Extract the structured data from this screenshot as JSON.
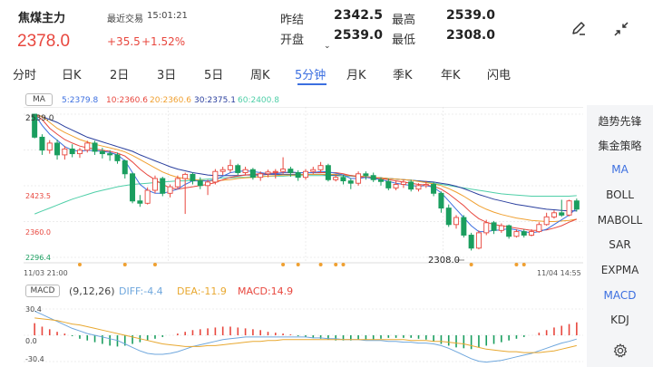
{
  "header": {
    "title": "焦煤主力",
    "last_trade_label": "最近交易",
    "last_trade_time": "15:01:21",
    "price": "2378.0",
    "change": "+35.5",
    "change_pct": "+1.52%",
    "prev_close_label": "昨结",
    "prev_close": "2342.5",
    "high_label": "最高",
    "high": "2539.0",
    "open_label": "开盘",
    "open": "2539.0",
    "low_label": "最低",
    "low": "2308.0",
    "up_color": "#e8473e",
    "down_color": "#1a9e5f"
  },
  "tabs": [
    {
      "label": "分时"
    },
    {
      "label": "日K"
    },
    {
      "label": "2日"
    },
    {
      "label": "3日"
    },
    {
      "label": "5日"
    },
    {
      "label": "周K"
    },
    {
      "label": "5分钟",
      "active": true
    },
    {
      "label": "月K"
    },
    {
      "label": "季K"
    },
    {
      "label": "年K"
    },
    {
      "label": "闪电"
    }
  ],
  "main_legend": {
    "badge": "MA",
    "ma5": "5:2379.8",
    "ma10": "10:2360.6",
    "ma20": "20:2360.6",
    "ma30": "30:2375.1",
    "ma60": "60:2400.8",
    "colors": {
      "ma5": "#3c6fe0",
      "ma10": "#e8473e",
      "ma20": "#f0a030",
      "ma30": "#2a3f9e",
      "ma60": "#4fcfa8"
    }
  },
  "price_axis": {
    "top": "2539.0",
    "y2": "2423.5",
    "y3": "2360.0",
    "y4": "2296.4",
    "low_marker": "2308.0"
  },
  "time_axis": {
    "start": "11/03 21:00",
    "end": "11/04 14:55"
  },
  "macd_legend": {
    "badge": "MACD",
    "params": "(9,12,26)",
    "diff": "DIFF:-4.4",
    "dea": "DEA:-11.9",
    "macd": "MACD:14.9",
    "y_top": "30.4",
    "y_mid": "0.0",
    "y_bot": "-30.4"
  },
  "side_menu": [
    {
      "label": "趋势先锋"
    },
    {
      "label": "集金策略"
    },
    {
      "label": "MA",
      "active": true
    },
    {
      "label": "BOLL"
    },
    {
      "label": "MABOLL"
    },
    {
      "label": "SAR"
    },
    {
      "label": "EXPMA"
    },
    {
      "label": "MACD",
      "active": true
    },
    {
      "label": "KDJ"
    }
  ],
  "chart_data": {
    "type": "candlestick",
    "y_range": [
      2296.4,
      2539.0
    ],
    "candles": [
      [
        2539.0,
        2500.0,
        2539.0,
        2498.0
      ],
      [
        2500.0,
        2478.0,
        2505.0,
        2470.0
      ],
      [
        2478.0,
        2490.0,
        2495.0,
        2472.0
      ],
      [
        2490.0,
        2470.0,
        2496.0,
        2462.0
      ],
      [
        2470.0,
        2480.0,
        2485.0,
        2462.0
      ],
      [
        2480.0,
        2472.0,
        2488.0,
        2466.0
      ],
      [
        2472.0,
        2478.0,
        2482.0,
        2465.0
      ],
      [
        2478.0,
        2490.0,
        2494.0,
        2474.0
      ],
      [
        2490.0,
        2476.0,
        2494.0,
        2470.0
      ],
      [
        2476.0,
        2472.0,
        2482.0,
        2464.0
      ],
      [
        2472.0,
        2470.0,
        2478.0,
        2460.0
      ],
      [
        2470.0,
        2460.0,
        2474.0,
        2455.0
      ],
      [
        2460.0,
        2438.0,
        2462.0,
        2430.0
      ],
      [
        2438.0,
        2392.0,
        2440.0,
        2388.0
      ],
      [
        2392.0,
        2388.0,
        2402.0,
        2382.0
      ],
      [
        2388.0,
        2410.0,
        2415.0,
        2386.0
      ],
      [
        2410.0,
        2430.0,
        2435.0,
        2405.0
      ],
      [
        2430.0,
        2405.0,
        2433.0,
        2400.0
      ],
      [
        2405.0,
        2416.0,
        2420.0,
        2398.0
      ],
      [
        2416.0,
        2430.0,
        2435.0,
        2412.0
      ],
      [
        2430.0,
        2437.0,
        2440.0,
        2370.0
      ],
      [
        2437.0,
        2426.0,
        2440.0,
        2420.0
      ],
      [
        2426.0,
        2418.0,
        2432.0,
        2412.0
      ],
      [
        2418.0,
        2424.0,
        2428.0,
        2402.0
      ],
      [
        2424.0,
        2442.0,
        2446.0,
        2420.0
      ],
      [
        2442.0,
        2445.0,
        2450.0,
        2436.0
      ],
      [
        2445.0,
        2452.0,
        2462.0,
        2440.0
      ],
      [
        2452.0,
        2440.0,
        2455.0,
        2436.0
      ],
      [
        2440.0,
        2445.0,
        2450.0,
        2435.0
      ],
      [
        2445.0,
        2432.0,
        2448.0,
        2428.0
      ],
      [
        2432.0,
        2438.0,
        2442.0,
        2426.0
      ],
      [
        2438.0,
        2441.0,
        2445.0,
        2432.0
      ],
      [
        2441.0,
        2442.0,
        2446.0,
        2430.0
      ],
      [
        2442.0,
        2446.0,
        2466.0,
        2438.0
      ],
      [
        2446.0,
        2440.0,
        2450.0,
        2433.0
      ],
      [
        2440.0,
        2432.0,
        2444.0,
        2426.0
      ],
      [
        2432.0,
        2442.0,
        2446.0,
        2428.0
      ],
      [
        2442.0,
        2445.0,
        2450.0,
        2438.0
      ],
      [
        2445.0,
        2452.0,
        2458.0,
        2440.0
      ],
      [
        2452.0,
        2428.0,
        2455.0,
        2425.0
      ],
      [
        2428.0,
        2432.0,
        2437.0,
        2425.0
      ],
      [
        2432.0,
        2426.0,
        2436.0,
        2420.0
      ],
      [
        2426.0,
        2422.0,
        2430.0,
        2412.0
      ],
      [
        2422.0,
        2438.0,
        2442.0,
        2418.0
      ],
      [
        2438.0,
        2435.0,
        2442.0,
        2428.0
      ],
      [
        2435.0,
        2428.0,
        2440.0,
        2424.0
      ],
      [
        2428.0,
        2425.0,
        2432.0,
        2418.0
      ],
      [
        2425.0,
        2414.0,
        2430.0,
        2410.0
      ],
      [
        2414.0,
        2420.0,
        2426.0,
        2410.0
      ],
      [
        2420.0,
        2424.0,
        2428.0,
        2414.0
      ],
      [
        2424.0,
        2412.0,
        2428.0,
        2408.0
      ],
      [
        2412.0,
        2418.0,
        2422.0,
        2408.0
      ],
      [
        2418.0,
        2420.0,
        2426.0,
        2414.0
      ],
      [
        2420.0,
        2405.0,
        2424.0,
        2400.0
      ],
      [
        2405.0,
        2380.0,
        2408.0,
        2372.0
      ],
      [
        2380.0,
        2352.0,
        2386.0,
        2348.0
      ],
      [
        2352.0,
        2364.0,
        2368.0,
        2345.0
      ],
      [
        2364.0,
        2334.0,
        2368.0,
        2330.0
      ],
      [
        2334.0,
        2312.0,
        2338.0,
        2308.0
      ],
      [
        2312.0,
        2338.0,
        2342.0,
        2310.0
      ],
      [
        2338.0,
        2355.0,
        2360.0,
        2334.0
      ],
      [
        2355.0,
        2342.0,
        2358.0,
        2336.0
      ],
      [
        2342.0,
        2350.0,
        2354.0,
        2338.0
      ],
      [
        2350.0,
        2332.0,
        2352.0,
        2328.0
      ],
      [
        2332.0,
        2340.0,
        2344.0,
        2330.0
      ],
      [
        2340.0,
        2334.0,
        2344.0,
        2330.0
      ],
      [
        2334.0,
        2340.0,
        2344.0,
        2332.0
      ],
      [
        2340.0,
        2352.0,
        2356.0,
        2338.0
      ],
      [
        2352.0,
        2365.0,
        2372.0,
        2350.0
      ],
      [
        2365.0,
        2372.0,
        2376.0,
        2362.0
      ],
      [
        2372.0,
        2368.0,
        2394.0,
        2365.0
      ],
      [
        2368.0,
        2392.0,
        2394.0,
        2366.0
      ],
      [
        2392.0,
        2378.0,
        2396.0,
        2374.0
      ]
    ],
    "ma_series": {
      "ma5": [
        2539,
        2520,
        2505,
        2495,
        2484,
        2478,
        2476,
        2478,
        2477,
        2476,
        2474,
        2470,
        2460,
        2440,
        2420,
        2410,
        2405,
        2405,
        2408,
        2412,
        2420,
        2426,
        2426,
        2426,
        2428,
        2434,
        2440,
        2442,
        2443,
        2442,
        2440,
        2438,
        2438,
        2440,
        2441,
        2440,
        2440,
        2440,
        2442,
        2441,
        2439,
        2436,
        2430,
        2430,
        2432,
        2430,
        2428,
        2425,
        2422,
        2420,
        2418,
        2417,
        2418,
        2415,
        2406,
        2392,
        2378,
        2364,
        2350,
        2340,
        2340,
        2342,
        2343,
        2345,
        2343,
        2340,
        2338,
        2340,
        2344,
        2352,
        2360,
        2368,
        2380
      ],
      "ma10": [
        2539,
        2530,
        2515,
        2505,
        2496,
        2490,
        2485,
        2482,
        2480,
        2478,
        2476,
        2473,
        2468,
        2458,
        2446,
        2436,
        2428,
        2420,
        2414,
        2412,
        2414,
        2416,
        2418,
        2420,
        2423,
        2428,
        2432,
        2434,
        2436,
        2437,
        2438,
        2439,
        2439,
        2440,
        2440,
        2440,
        2440,
        2440,
        2440,
        2440,
        2440,
        2438,
        2435,
        2433,
        2432,
        2431,
        2430,
        2428,
        2426,
        2424,
        2422,
        2420,
        2419,
        2417,
        2412,
        2404,
        2394,
        2384,
        2372,
        2362,
        2356,
        2352,
        2350,
        2348,
        2346,
        2344,
        2342,
        2342,
        2343,
        2346,
        2350,
        2356,
        2361
      ],
      "ma20": [
        2539,
        2535,
        2525,
        2515,
        2508,
        2502,
        2496,
        2492,
        2488,
        2485,
        2482,
        2479,
        2475,
        2469,
        2462,
        2455,
        2448,
        2441,
        2436,
        2432,
        2430,
        2428,
        2427,
        2426,
        2426,
        2427,
        2428,
        2430,
        2431,
        2432,
        2433,
        2434,
        2435,
        2436,
        2436,
        2436,
        2437,
        2437,
        2437,
        2437,
        2437,
        2436,
        2435,
        2434,
        2433,
        2432,
        2431,
        2430,
        2429,
        2428,
        2427,
        2425,
        2423,
        2421,
        2418,
        2413,
        2407,
        2400,
        2392,
        2384,
        2378,
        2373,
        2369,
        2366,
        2363,
        2361,
        2359,
        2358,
        2357,
        2357,
        2358,
        2359,
        2361
      ],
      "ma30": [
        2539,
        2535,
        2530,
        2525,
        2518,
        2512,
        2506,
        2500,
        2496,
        2492,
        2488,
        2484,
        2480,
        2476,
        2470,
        2465,
        2460,
        2455,
        2450,
        2446,
        2443,
        2440,
        2438,
        2436,
        2435,
        2435,
        2435,
        2435,
        2436,
        2436,
        2436,
        2437,
        2437,
        2437,
        2437,
        2437,
        2437,
        2437,
        2437,
        2436,
        2436,
        2436,
        2435,
        2434,
        2433,
        2432,
        2431,
        2430,
        2429,
        2428,
        2427,
        2426,
        2425,
        2424,
        2422,
        2420,
        2417,
        2413,
        2408,
        2403,
        2399,
        2395,
        2392,
        2389,
        2386,
        2384,
        2382,
        2380,
        2378,
        2377,
        2376,
        2375,
        2375
      ],
      "ma60": [
        2370,
        2375,
        2380,
        2385,
        2390,
        2395,
        2399,
        2403,
        2407,
        2410,
        2413,
        2416,
        2418,
        2420,
        2421,
        2422,
        2423,
        2424,
        2425,
        2426,
        2426,
        2427,
        2428,
        2429,
        2430,
        2431,
        2431,
        2432,
        2432,
        2433,
        2433,
        2434,
        2434,
        2434,
        2435,
        2435,
        2435,
        2435,
        2435,
        2435,
        2435,
        2434,
        2434,
        2433,
        2433,
        2432,
        2431,
        2430,
        2429,
        2428,
        2427,
        2426,
        2424,
        2422,
        2420,
        2418,
        2416,
        2414,
        2412,
        2410,
        2408,
        2406,
        2404,
        2403,
        2402,
        2401,
        2400,
        2400,
        2400,
        2400,
        2400,
        2400,
        2401
      ]
    },
    "signal_dots_index": [
      6,
      12,
      16,
      33,
      35,
      38,
      40,
      41,
      58,
      64,
      65
    ],
    "macd": {
      "y_range": [
        -30.4,
        30.4
      ],
      "hist": [
        14,
        10,
        7,
        4,
        2,
        -1,
        -4,
        -6,
        -8,
        -10,
        -12,
        -13,
        -12,
        -10,
        -8,
        -6,
        -4,
        -2,
        0,
        2,
        4,
        6,
        7,
        8,
        9,
        10,
        10,
        9,
        8,
        7,
        6,
        4,
        3,
        2,
        1,
        -1,
        -2,
        -3,
        -4,
        -5,
        -6,
        -6,
        -6,
        -5,
        -5,
        -5,
        -4,
        -3,
        -3,
        -3,
        -3,
        -4,
        -5,
        -7,
        -10,
        -12,
        -14,
        -15,
        -16,
        -14,
        -12,
        -10,
        -8,
        -6,
        -4,
        -2,
        0,
        3,
        6,
        9,
        11,
        13,
        15
      ],
      "diff": [
        28,
        24,
        20,
        16,
        12,
        8,
        5,
        2,
        0,
        -2,
        -4,
        -6,
        -10,
        -14,
        -18,
        -21,
        -22,
        -22,
        -21,
        -19,
        -16,
        -13,
        -11,
        -9,
        -7,
        -5,
        -4,
        -3,
        -2,
        -2,
        -2,
        -2,
        -2,
        -2,
        -2,
        -2,
        -2,
        -3,
        -3,
        -4,
        -4,
        -5,
        -5,
        -5,
        -6,
        -6,
        -6,
        -7,
        -7,
        -8,
        -8,
        -9,
        -9,
        -10,
        -12,
        -15,
        -19,
        -23,
        -27,
        -30,
        -31,
        -30,
        -29,
        -27,
        -25,
        -23,
        -21,
        -18,
        -15,
        -12,
        -9,
        -7,
        -4.4
      ],
      "dea": [
        20,
        19,
        18,
        17,
        15,
        13,
        12,
        10,
        8,
        6,
        4,
        2,
        0,
        -2,
        -4,
        -6,
        -8,
        -10,
        -11,
        -12,
        -13,
        -13,
        -13,
        -12,
        -12,
        -11,
        -10,
        -9,
        -8,
        -7,
        -7,
        -6,
        -6,
        -5,
        -5,
        -5,
        -5,
        -5,
        -5,
        -5,
        -5,
        -5,
        -5,
        -5,
        -5,
        -5,
        -5,
        -5,
        -5,
        -5,
        -6,
        -6,
        -6,
        -7,
        -7,
        -8,
        -9,
        -10,
        -12,
        -14,
        -16,
        -17,
        -18,
        -19,
        -19,
        -20,
        -20,
        -20,
        -19,
        -18,
        -16,
        -14,
        -11.9
      ]
    }
  }
}
